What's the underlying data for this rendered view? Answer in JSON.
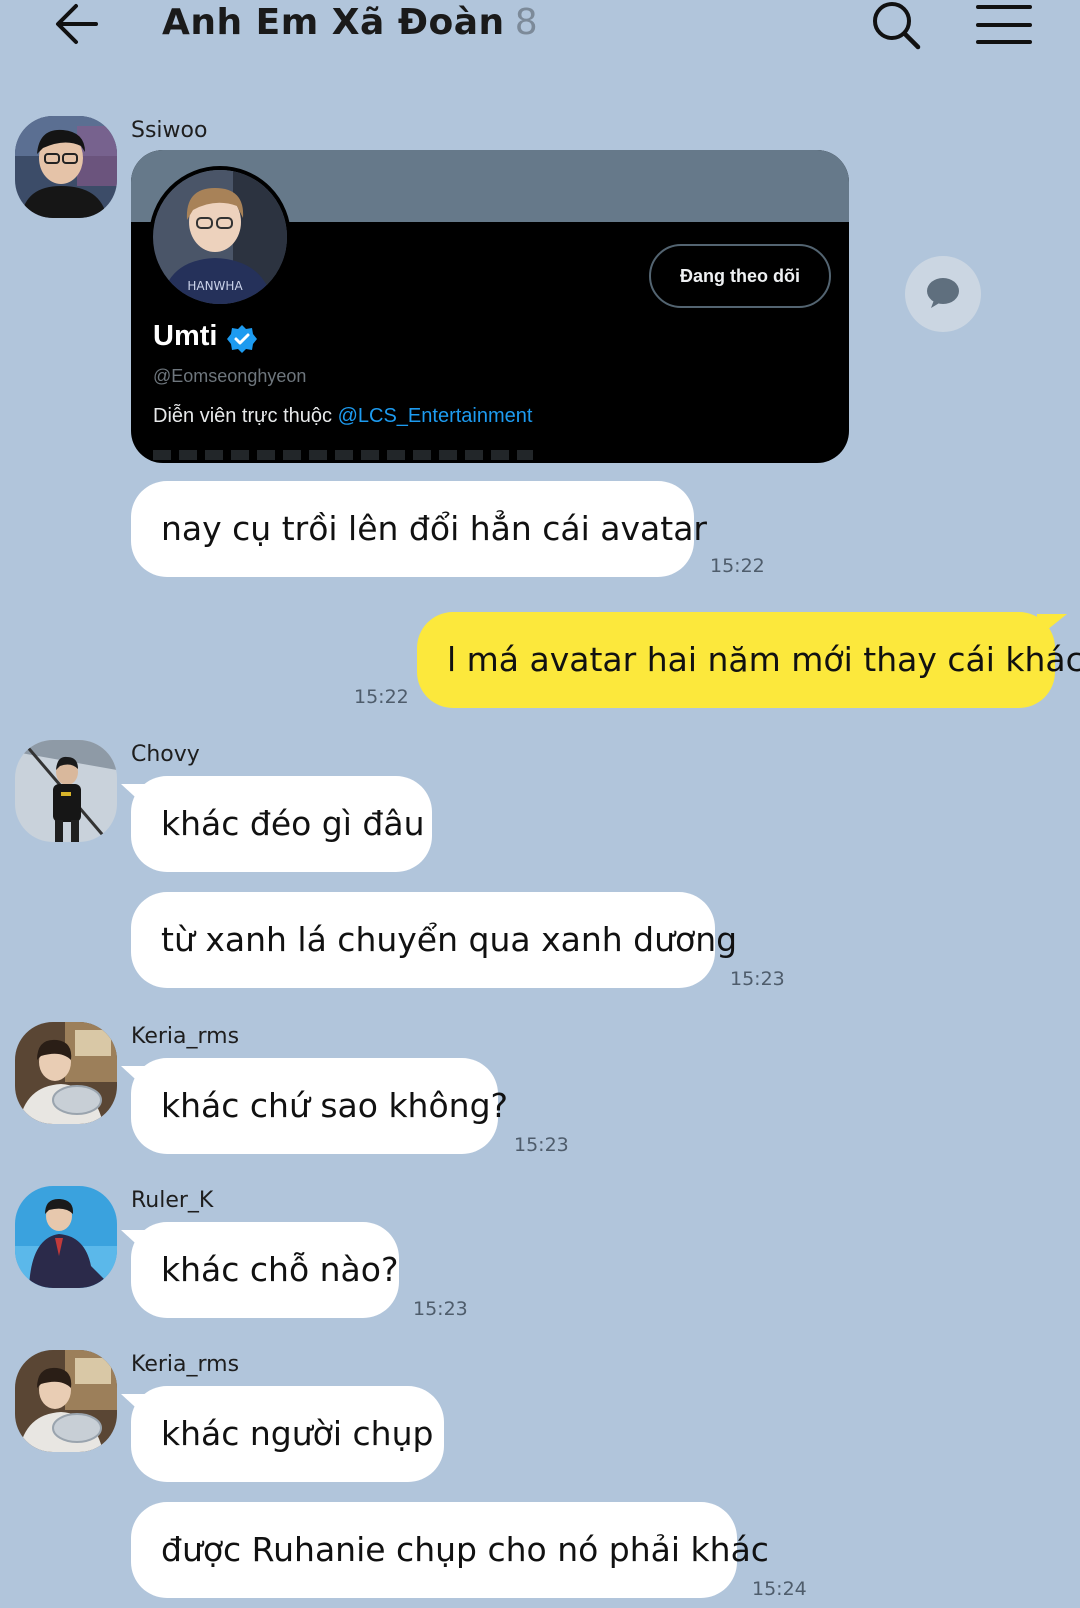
{
  "header": {
    "title": "Anh Em Xã Đoàn",
    "member_count": "8"
  },
  "messages": {
    "m1": {
      "sender": "Ssiwoo",
      "card": {
        "name": "Umti",
        "handle": "@Eomseonghyeon",
        "bio_prefix": "Diễn viên trực thuộc ",
        "bio_mention": "@LCS_Entertainment",
        "follow_label": "Đang theo dõi"
      },
      "text": "nay cụ trồi lên đổi hẳn cái avatar",
      "time": "15:22"
    },
    "m2": {
      "text": "l má avatar hai năm mới thay cái khác",
      "time": "15:22"
    },
    "m3": {
      "sender": "Chovy",
      "text1": "khác đéo gì đâu",
      "text2": "từ xanh lá chuyển qua xanh dương",
      "time": "15:23"
    },
    "m4": {
      "sender": "Keria_rms",
      "text": "khác chứ sao không?",
      "time": "15:23"
    },
    "m5": {
      "sender": "Ruler_K",
      "text": "khác chỗ nào?",
      "time": "15:23"
    },
    "m6": {
      "sender": "Keria_rms",
      "text1": "khác người chụp",
      "text2": "được Ruhanie chụp cho nó phải khác",
      "time": "15:24"
    }
  }
}
